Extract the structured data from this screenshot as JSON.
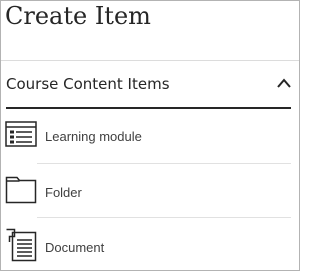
{
  "panel": {
    "title": "Create Item"
  },
  "section": {
    "title": "Course Content Items",
    "expanded": true,
    "toggle_icon": "chevron-up-icon",
    "items": [
      {
        "label": "Learning module",
        "icon": "learning-module-icon"
      },
      {
        "label": "Folder",
        "icon": "folder-icon"
      },
      {
        "label": "Document",
        "icon": "document-icon"
      }
    ]
  }
}
